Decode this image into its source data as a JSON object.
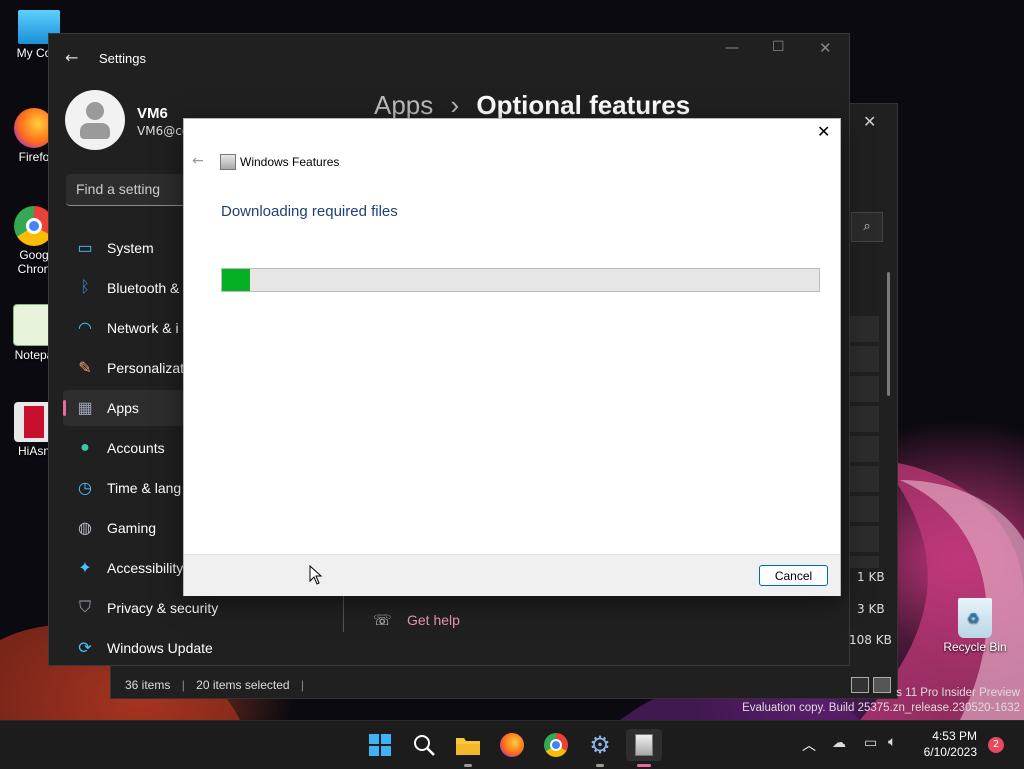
{
  "desktop": {
    "icons": [
      {
        "label": "My Com",
        "icon": "computer-icon"
      },
      {
        "label": "Firefo",
        "icon": "firefox-icon"
      },
      {
        "label": "Goog Chron",
        "icon": "chrome-icon"
      },
      {
        "label": "Notepa",
        "icon": "notepad-icon"
      },
      {
        "label": "HiAsn",
        "icon": "hiasm-icon"
      },
      {
        "label": "Recycle Bin",
        "icon": "recycle-bin-icon"
      }
    ],
    "watermark_line1": "s 11 Pro Insider Preview",
    "watermark_line2": "Evaluation copy. Build 25375.zn_release.230520-1632"
  },
  "explorer": {
    "status_items": "36 items",
    "status_selected": "20 items selected",
    "sizes": [
      "1 KB",
      "3 KB",
      "108 KB"
    ]
  },
  "settings": {
    "title": "Settings",
    "user_name": "VM6",
    "user_email": "VM6@co",
    "search_placeholder": "Find a setting",
    "breadcrumb_parent": "Apps",
    "breadcrumb_sep": "›",
    "breadcrumb_current": "Optional features",
    "nav": [
      {
        "label": "System",
        "icon": "system-icon",
        "color": "#4cc2ff"
      },
      {
        "label": "Bluetooth &",
        "icon": "bluetooth-icon",
        "color": "#2b88d8"
      },
      {
        "label": "Network & i",
        "icon": "wifi-icon",
        "color": "#4cc2ff"
      },
      {
        "label": "Personalizat",
        "icon": "brush-icon",
        "color": "#f0a36b"
      },
      {
        "label": "Apps",
        "icon": "apps-icon",
        "color": "#9aa4b8"
      },
      {
        "label": "Accounts",
        "icon": "accounts-icon",
        "color": "#3fc5a8"
      },
      {
        "label": "Time & lang",
        "icon": "time-icon",
        "color": "#4cc2ff"
      },
      {
        "label": "Gaming",
        "icon": "gaming-icon",
        "color": "#b8bcc4"
      },
      {
        "label": "Accessibility",
        "icon": "accessibility-icon",
        "color": "#4cc2ff"
      },
      {
        "label": "Privacy & security",
        "icon": "shield-icon",
        "color": "#9aa4b8"
      },
      {
        "label": "Windows Update",
        "icon": "update-icon",
        "color": "#4cc2ff"
      }
    ],
    "get_help": "Get help"
  },
  "dialog": {
    "title": "Windows Features",
    "heading": "Downloading required files",
    "progress_fraction": 0.047,
    "cancel_label": "Cancel",
    "accent": "#06b025"
  },
  "taskbar": {
    "time": "4:53 PM",
    "date": "6/10/2023",
    "notifications": "2"
  }
}
